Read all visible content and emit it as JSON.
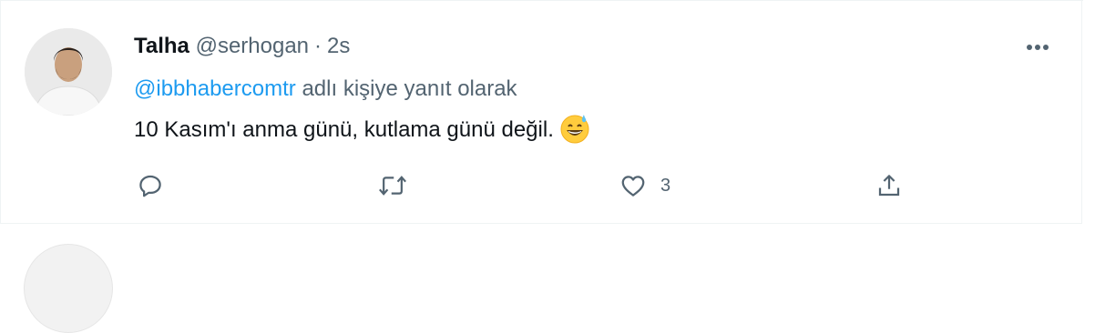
{
  "tweet": {
    "author_name": "Talha",
    "author_handle": "@serhogan",
    "separator": "·",
    "timestamp": "2s",
    "reply_prefix_mention": "@ibbhabercomtr",
    "reply_suffix": " adlı kişiye yanıt olarak",
    "text": "10 Kasım'ı anma günü, kutlama günü değil.",
    "emoji": "grinning-face-with-sweat",
    "actions": {
      "reply_icon": "reply-icon",
      "retweet_icon": "retweet-icon",
      "like_icon": "like-icon",
      "like_count": "3",
      "share_icon": "share-icon"
    }
  },
  "colors": {
    "text_primary": "#0f1419",
    "text_secondary": "#536471",
    "link": "#1d9bf0",
    "border": "#eff3f4"
  }
}
